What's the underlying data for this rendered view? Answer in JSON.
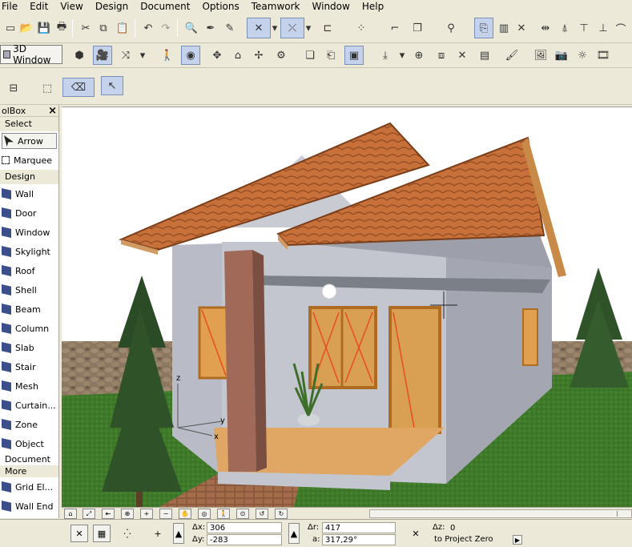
{
  "menu": [
    "File",
    "Edit",
    "View",
    "Design",
    "Document",
    "Options",
    "Teamwork",
    "Window",
    "Help"
  ],
  "toolbar": {
    "view_3d_label": "3D Window"
  },
  "toolbox": {
    "title": "olBox",
    "close": "×",
    "sections": {
      "select": "Select",
      "design": "Design",
      "document": "Document",
      "more": "More"
    },
    "select_items": [
      "Arrow",
      "Marquee"
    ],
    "design_items": [
      "Wall",
      "Door",
      "Window",
      "Skylight",
      "Roof",
      "Shell",
      "Beam",
      "Column",
      "Slab",
      "Stair",
      "Mesh",
      "Curtain...",
      "Zone",
      "Object"
    ],
    "more_items": [
      "Grid El...",
      "Wall End"
    ]
  },
  "viewport": {
    "axis_z": "z",
    "axis_y": "y",
    "axis_x": "x"
  },
  "infobox": {
    "dx_label": "Δx:",
    "dx_value": "306",
    "dy_label": "Δy:",
    "dy_value": "-283",
    "dr_label": "Δr:",
    "dr_value": "417",
    "a_label": "a:",
    "a_value": "317,29°",
    "dz_label": "Δz:",
    "dz_value": "0",
    "reference": "to Project Zero"
  },
  "colors": {
    "roof": "#c8703a",
    "wall": "#b9bcc6",
    "grass": "#3f7a2a",
    "stone": "#8b7762",
    "floor": "#e0a663"
  }
}
